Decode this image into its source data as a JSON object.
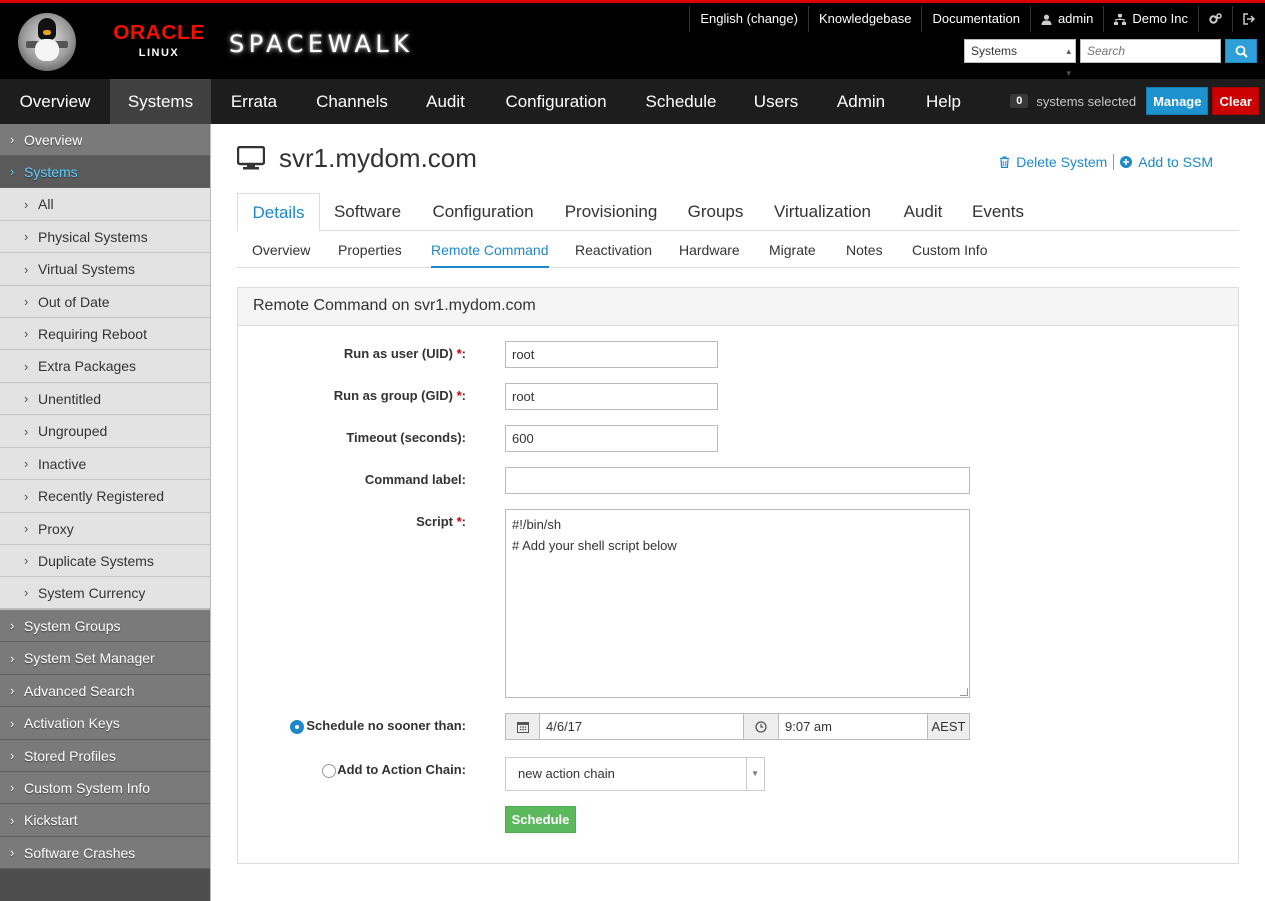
{
  "header": {
    "oracle_word": "ORACLE",
    "oracle_sub": "LINUX",
    "product": "SPACEWALK",
    "utility_links": [
      {
        "label": "English (change)",
        "icon": ""
      },
      {
        "label": "Knowledgebase",
        "icon": ""
      },
      {
        "label": "Documentation",
        "icon": ""
      },
      {
        "label": "admin",
        "icon": "user-icon"
      },
      {
        "label": "Demo Inc",
        "icon": "org-icon"
      },
      {
        "label": "",
        "icon": "gears-icon"
      },
      {
        "label": "",
        "icon": "sign-out-icon"
      }
    ],
    "search_select": "Systems",
    "search_placeholder": "Search"
  },
  "nav": {
    "items": [
      "Overview",
      "Systems",
      "Errata",
      "Channels",
      "Audit",
      "Configuration",
      "Schedule",
      "Users",
      "Admin",
      "Help"
    ],
    "active": "Systems"
  },
  "ssm": {
    "count": "0",
    "label": "systems selected",
    "manage": "Manage",
    "clear": "Clear"
  },
  "sidebar": {
    "items": [
      {
        "label": "Overview",
        "level": "top"
      },
      {
        "label": "Systems",
        "level": "top",
        "active": true
      },
      {
        "label": "All",
        "level": "sub"
      },
      {
        "label": "Physical Systems",
        "level": "sub"
      },
      {
        "label": "Virtual Systems",
        "level": "sub"
      },
      {
        "label": "Out of Date",
        "level": "sub"
      },
      {
        "label": "Requiring Reboot",
        "level": "sub"
      },
      {
        "label": "Extra Packages",
        "level": "sub"
      },
      {
        "label": "Unentitled",
        "level": "sub"
      },
      {
        "label": "Ungrouped",
        "level": "sub"
      },
      {
        "label": "Inactive",
        "level": "sub"
      },
      {
        "label": "Recently Registered",
        "level": "sub"
      },
      {
        "label": "Proxy",
        "level": "sub"
      },
      {
        "label": "Duplicate Systems",
        "level": "sub"
      },
      {
        "label": "System Currency",
        "level": "sub"
      },
      {
        "label": "System Groups",
        "level": "top"
      },
      {
        "label": "System Set Manager",
        "level": "top"
      },
      {
        "label": "Advanced Search",
        "level": "top"
      },
      {
        "label": "Activation Keys",
        "level": "top"
      },
      {
        "label": "Stored Profiles",
        "level": "top"
      },
      {
        "label": "Custom System Info",
        "level": "top"
      },
      {
        "label": "Kickstart",
        "level": "top"
      },
      {
        "label": "Software Crashes",
        "level": "top"
      }
    ]
  },
  "page": {
    "title": "svr1.mydom.com",
    "actions": [
      "Delete System",
      "Add to SSM"
    ],
    "main_tabs": [
      "Details",
      "Software",
      "Configuration",
      "Provisioning",
      "Groups",
      "Virtualization",
      "Audit",
      "Events"
    ],
    "main_tab_active": "Details",
    "sub_tabs": [
      "Overview",
      "Properties",
      "Remote Command",
      "Reactivation",
      "Hardware",
      "Migrate",
      "Notes",
      "Custom Info"
    ],
    "sub_tab_active": "Remote Command"
  },
  "form": {
    "heading": "Remote Command on svr1.mydom.com",
    "run_as_user_label": "Run as user (UID)",
    "run_as_user_value": "root",
    "run_as_group_label": "Run as group (GID)",
    "run_as_group_value": "root",
    "timeout_label": "Timeout (seconds):",
    "timeout_value": "600",
    "command_label_label": "Command label:",
    "command_label_value": "",
    "script_label": "Script",
    "script_line1": "#!/bin/sh",
    "script_line2": "# Add your shell script below",
    "schedule_label": "Schedule no sooner than:",
    "schedule_checked": true,
    "date_value": "4/6/17",
    "time_value": "9:07 am",
    "timezone": "AEST",
    "action_chain_label": "Add to Action Chain:",
    "action_chain_value": "new action chain",
    "submit": "Schedule",
    "required_mark": "*",
    "colon": ":"
  }
}
